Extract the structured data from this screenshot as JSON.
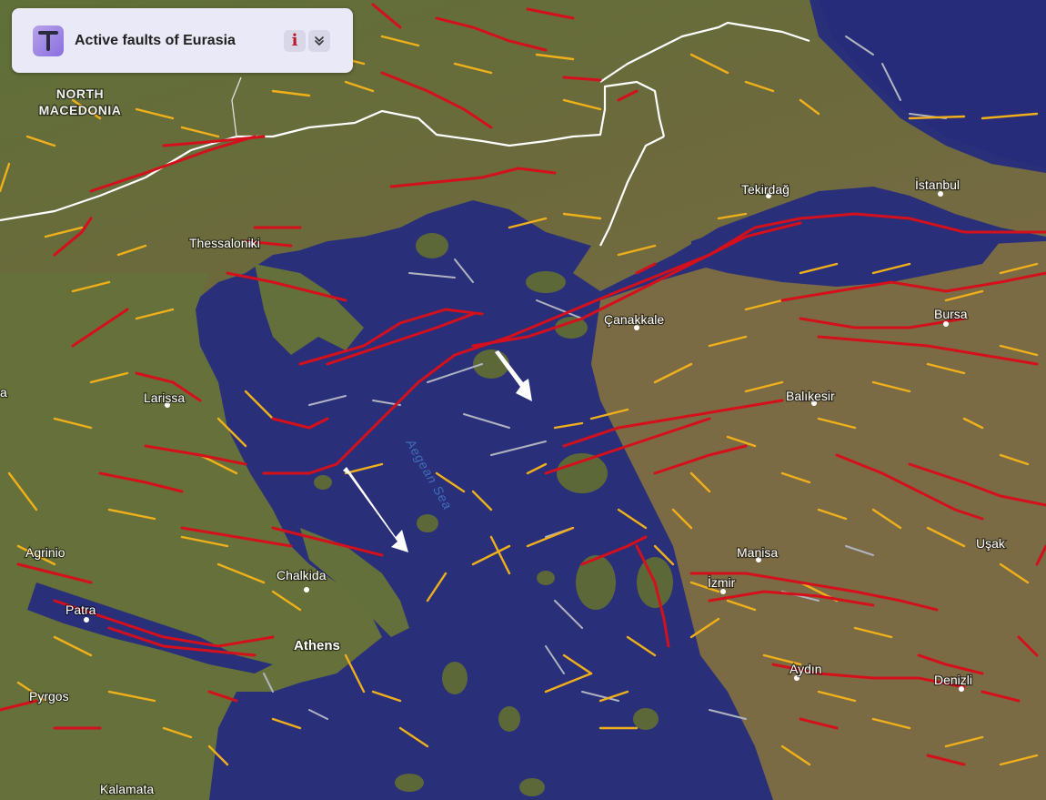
{
  "panel": {
    "title": "Active faults of Eurasia",
    "info_icon": "info-icon",
    "collapse_icon": "chevron-double-down-icon",
    "info_glyph": "i",
    "collapse_glyph": "⌄"
  },
  "labels": {
    "country_north_macedonia_line1": "NORTH",
    "country_north_macedonia_line2": "MACEDONIA",
    "city_thessaloniki": "Thessaloniki",
    "city_larissa": "Larissa",
    "city_agrinio": "Agrinio",
    "city_patra": "Patra",
    "city_pyrgos": "Pyrgos",
    "city_kalamata": "Kalamata",
    "city_chalkida": "Chalkida",
    "city_athens": "Athens",
    "city_tekirdag": "Tekirdağ",
    "city_istanbul": "İstanbul",
    "city_canakkale": "Çanakkale",
    "city_bursa": "Bursa",
    "city_balikesir": "Balıkesir",
    "city_manisa": "Manisa",
    "city_izmir": "İzmir",
    "city_usak": "Uşak",
    "city_aydin": "Aydın",
    "city_denizli": "Denizli",
    "sea_aegean": "Aegean Sea",
    "edge_a": "a"
  },
  "colors": {
    "sea": "#2a2f7a",
    "land": "#5c6e3a",
    "fault_major": "#d4101c",
    "fault_minor": "#f0b01a",
    "fault_inactive": "#b0b4c0",
    "border": "#ffffff"
  }
}
